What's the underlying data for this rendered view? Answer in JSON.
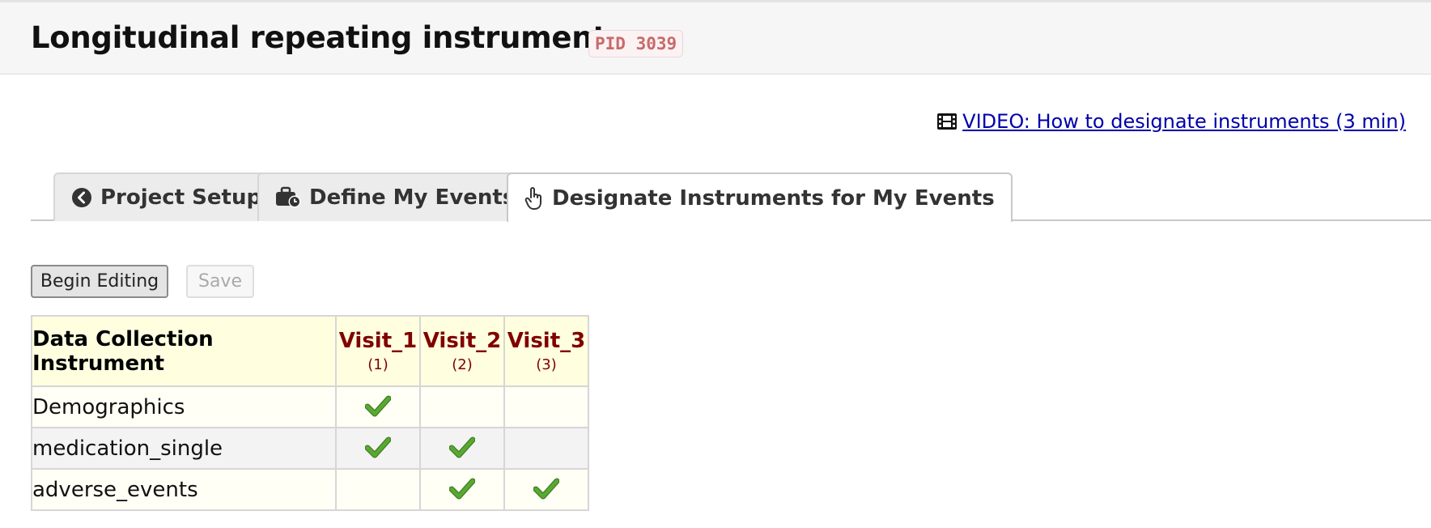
{
  "header": {
    "title": "Longitudinal repeating instruments",
    "pid_badge": "PID 3039"
  },
  "video_link": {
    "icon": "film-icon",
    "label": "VIDEO: How to designate instruments (3 min)"
  },
  "tabs": [
    {
      "label": "Project Setup",
      "icon": "chevron-left-circle-icon",
      "active": false
    },
    {
      "label": "Define My Events",
      "icon": "briefcase-clock-icon",
      "active": false
    },
    {
      "label": "Designate Instruments for My Events",
      "icon": "hand-pointer-icon",
      "active": true
    }
  ],
  "buttons": {
    "begin_editing": "Begin Editing",
    "save": "Save"
  },
  "table": {
    "header": "Data Collection Instrument",
    "events": [
      {
        "name": "Visit_1",
        "number": "(1)"
      },
      {
        "name": "Visit_2",
        "number": "(2)"
      },
      {
        "name": "Visit_3",
        "number": "(3)"
      }
    ],
    "rows": [
      {
        "instrument": "Demographics",
        "checks": [
          true,
          false,
          false
        ]
      },
      {
        "instrument": "medication_single",
        "checks": [
          true,
          true,
          false
        ]
      },
      {
        "instrument": "adverse_events",
        "checks": [
          false,
          true,
          true
        ]
      }
    ]
  },
  "colors": {
    "event_name": "#800000",
    "header_bg": "#ffffe0",
    "check_green": "#5aa832",
    "link": "#0000aa"
  }
}
